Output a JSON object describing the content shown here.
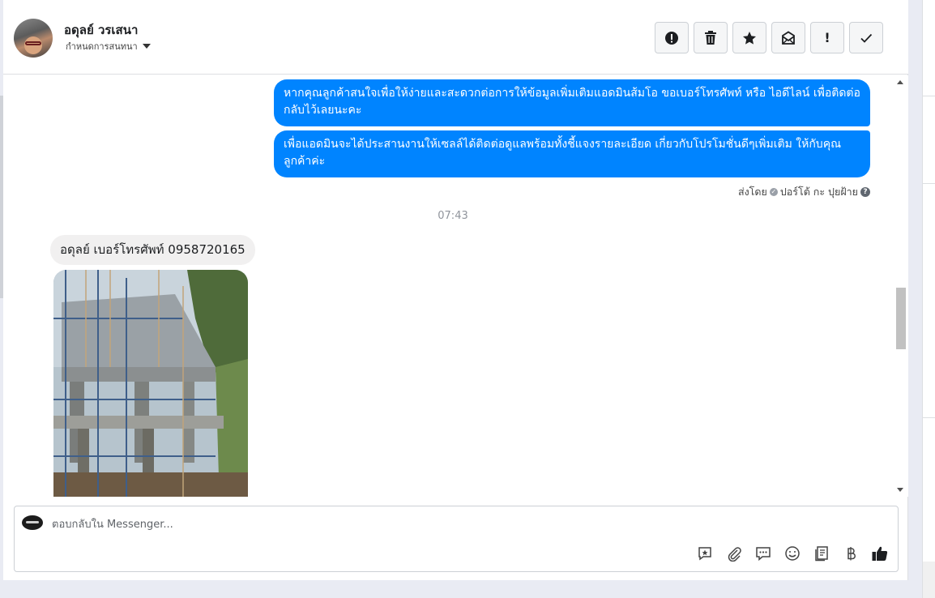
{
  "contact": {
    "name": "อดุลย์ วรเสนา",
    "assign_label": "กำหนดการสนทนา"
  },
  "actions": [
    {
      "name": "mark-spam-button",
      "icon": "exclamation-circle-icon"
    },
    {
      "name": "delete-button",
      "icon": "trash-icon"
    },
    {
      "name": "star-button",
      "icon": "star-icon"
    },
    {
      "name": "mark-unread-button",
      "icon": "envelope-icon"
    },
    {
      "name": "follow-up-button",
      "icon": "exclamation-icon",
      "glyph": "!"
    },
    {
      "name": "mark-done-button",
      "icon": "check-icon"
    }
  ],
  "thread": {
    "outgoing": [
      "หากคุณลูกค้าสนใจเพื่อให้ง่ายและสะดวกต่อการให้ข้อมูลเพิ่มเติมแอดมินส้มโอ ขอเบอร์โทรศัพท์ หรือ ไอดีไลน์ เพื่อติดต่อกลับไว้เลยนะคะ",
      "เพื่อแอดมินจะได้ประสานงานให้เซลล์ได้ติดต่อดูแลพร้อมทั้งชี้แจงรายละเอียด เกี่ยวกับโปรโมชั่นดีๆเพิ่มเติม ให้กับคุณลูกค้าค่ะ"
    ],
    "sent_by_prefix": "ส่งโดย",
    "sent_by_name": "ปอร์โต้ กะ ปุยฝ้าย",
    "timestamp": "07:43",
    "incoming_text": "อดุลย์  เบอร์โทรศัพท์  0958720165"
  },
  "composer": {
    "placeholder": "ตอบกลับใน Messenger...",
    "tools": [
      "saved-reply-icon",
      "attachment-icon",
      "chat-bubble-icon",
      "emoji-icon",
      "notes-icon",
      "baht-icon",
      "thumbs-up-icon"
    ]
  },
  "colors": {
    "outgoing_bubble": "#0084ff",
    "incoming_bubble": "#f1f0f0"
  }
}
